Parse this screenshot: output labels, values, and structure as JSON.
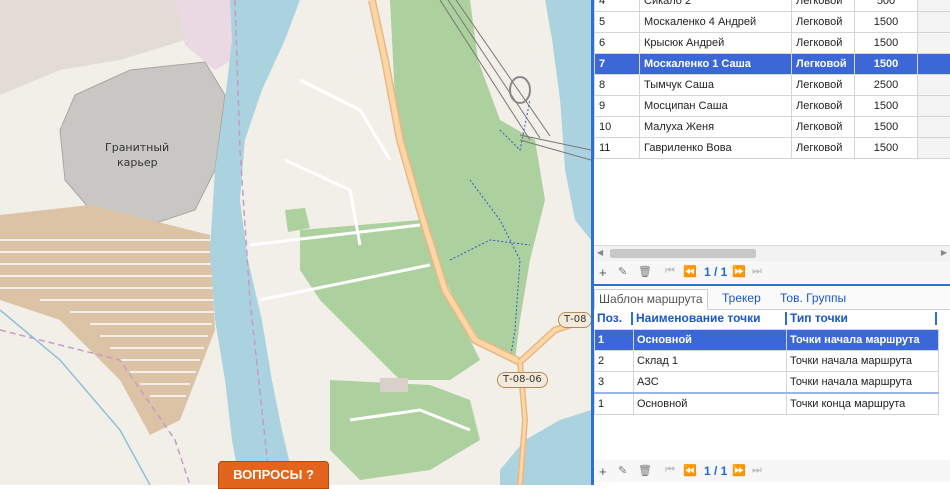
{
  "map": {
    "labels": {
      "quarry_line1": "Гранитный",
      "quarry_line2": "карьер"
    },
    "shields": {
      "road_top": "Т-08",
      "road_bottom": "Т-08-06"
    },
    "questions_button": "ВОПРОСЫ ?"
  },
  "drivers": {
    "rows": [
      {
        "num": "4",
        "name": "Сикало 2",
        "type": "Легковой",
        "value": "500",
        "selected": false
      },
      {
        "num": "5",
        "name": "Москаленко 4 Андрей",
        "type": "Легковой",
        "value": "1500",
        "selected": false
      },
      {
        "num": "6",
        "name": "Крысюк Андрей",
        "type": "Легковой",
        "value": "1500",
        "selected": false
      },
      {
        "num": "7",
        "name": "Москаленко 1 Саша",
        "type": "Легковой",
        "value": "1500",
        "selected": true
      },
      {
        "num": "8",
        "name": "Тымчук Саша",
        "type": "Легковой",
        "value": "2500",
        "selected": false
      },
      {
        "num": "9",
        "name": "Мосципан Саша",
        "type": "Легковой",
        "value": "1500",
        "selected": false
      },
      {
        "num": "10",
        "name": "Малуха Женя",
        "type": "Легковой",
        "value": "1500",
        "selected": false
      },
      {
        "num": "11",
        "name": "Гавриленко Вова",
        "type": "Легковой",
        "value": "1500",
        "selected": false
      }
    ],
    "pager": "1 / 1"
  },
  "tabs": [
    {
      "label": "Шаблон маршрута",
      "active": true
    },
    {
      "label": "Трекер",
      "active": false
    },
    {
      "label": "Тов. Группы",
      "active": false
    }
  ],
  "route": {
    "headers": {
      "pos": "Поз.",
      "name": "Наименование точки",
      "type": "Тип точки"
    },
    "rows": [
      {
        "pos": "1",
        "name": "Основной",
        "type": "Точки начала маршрута",
        "selected": true
      },
      {
        "pos": "2",
        "name": "Склад 1",
        "type": "Точки начала маршрута",
        "selected": false
      },
      {
        "pos": "3",
        "name": "АЗС",
        "type": "Точки начала маршрута",
        "selected": false
      },
      {
        "pos": "1",
        "name": "Основной",
        "type": "Точки конца маршрута",
        "selected": false
      }
    ],
    "pager": "1 / 1"
  },
  "icons": [
    "add-icon",
    "edit-icon",
    "delete-icon",
    "first-page-icon",
    "prev-page-icon",
    "next-page-icon",
    "last-page-icon"
  ],
  "colors": {
    "accent": "#2c6fd6",
    "selection": "#3b68d6",
    "questions": "#e3641c"
  }
}
